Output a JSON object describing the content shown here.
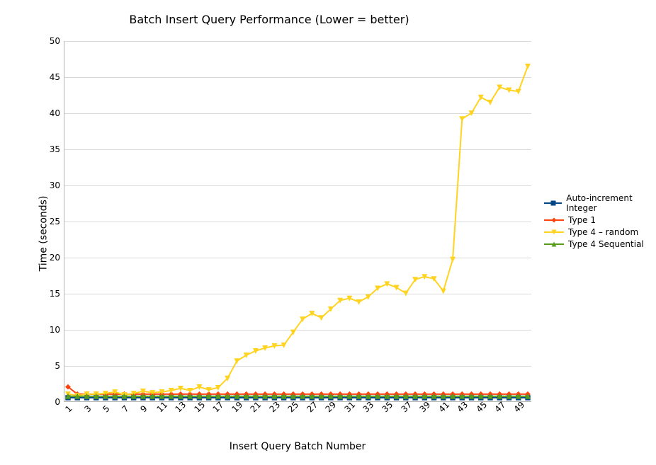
{
  "chart_data": {
    "type": "line",
    "title": "Batch Insert Query Performance (Lower = better)",
    "xlabel": "Insert Query Batch Number",
    "ylabel": "Time (seconds)",
    "ylim": [
      0,
      50
    ],
    "yticks": [
      0,
      5,
      10,
      15,
      20,
      25,
      30,
      35,
      40,
      45,
      50
    ],
    "x": [
      1,
      2,
      3,
      4,
      5,
      6,
      7,
      8,
      9,
      10,
      11,
      12,
      13,
      14,
      15,
      16,
      17,
      18,
      19,
      20,
      21,
      22,
      23,
      24,
      25,
      26,
      27,
      28,
      29,
      30,
      31,
      32,
      33,
      34,
      35,
      36,
      37,
      38,
      39,
      40,
      41,
      42,
      43,
      44,
      45,
      46,
      47,
      48,
      49,
      50
    ],
    "xticks_shown": [
      1,
      3,
      5,
      7,
      9,
      11,
      13,
      15,
      17,
      19,
      21,
      23,
      25,
      27,
      29,
      31,
      33,
      35,
      37,
      39,
      41,
      43,
      45,
      47,
      49
    ],
    "series": [
      {
        "name": "Auto-increment Integer",
        "color": "#004586",
        "marker": "square",
        "values": [
          0.5,
          0.5,
          0.5,
          0.5,
          0.5,
          0.5,
          0.5,
          0.5,
          0.5,
          0.5,
          0.5,
          0.5,
          0.5,
          0.5,
          0.5,
          0.5,
          0.5,
          0.5,
          0.5,
          0.5,
          0.5,
          0.5,
          0.5,
          0.5,
          0.5,
          0.5,
          0.5,
          0.5,
          0.5,
          0.5,
          0.5,
          0.5,
          0.5,
          0.5,
          0.5,
          0.5,
          0.5,
          0.5,
          0.5,
          0.5,
          0.5,
          0.5,
          0.5,
          0.5,
          0.5,
          0.5,
          0.5,
          0.5,
          0.5,
          0.5
        ]
      },
      {
        "name": "Type 1",
        "color": "#ff420e",
        "marker": "diamond",
        "values": [
          2.0,
          1.0,
          1.0,
          1.0,
          1.0,
          1.0,
          1.0,
          1.0,
          1.0,
          1.0,
          1.0,
          1.0,
          1.0,
          1.0,
          1.0,
          1.0,
          1.0,
          1.0,
          1.0,
          1.0,
          1.0,
          1.0,
          1.0,
          1.0,
          1.0,
          1.0,
          1.0,
          1.0,
          1.0,
          1.0,
          1.0,
          1.0,
          1.0,
          1.0,
          1.0,
          1.0,
          1.0,
          1.0,
          1.0,
          1.0,
          1.0,
          1.0,
          1.0,
          1.0,
          1.0,
          1.0,
          1.0,
          1.0,
          1.0,
          1.0
        ]
      },
      {
        "name": "Type 4 – random",
        "color": "#ffd320",
        "marker": "triangle-down",
        "values": [
          1.0,
          0.8,
          1.0,
          1.0,
          1.1,
          1.3,
          0.9,
          1.1,
          1.4,
          1.2,
          1.3,
          1.5,
          1.8,
          1.5,
          2.0,
          1.6,
          1.9,
          3.2,
          5.6,
          6.4,
          7.0,
          7.4,
          7.7,
          7.8,
          9.6,
          11.4,
          12.2,
          11.6,
          12.8,
          14.0,
          14.3,
          13.8,
          14.5,
          15.7,
          16.3,
          15.8,
          15.0,
          16.9,
          17.3,
          17.0,
          15.3,
          19.7,
          39.2,
          40.0,
          42.2,
          41.5,
          43.6,
          43.2,
          43.0,
          46.5
        ]
      },
      {
        "name": "Type 4 Sequential",
        "color": "#579d1c",
        "marker": "triangle-up",
        "values": [
          0.7,
          0.7,
          0.7,
          0.7,
          0.7,
          0.7,
          0.7,
          0.7,
          0.7,
          0.7,
          0.7,
          0.7,
          0.7,
          0.7,
          0.7,
          0.7,
          0.7,
          0.7,
          0.7,
          0.7,
          0.7,
          0.7,
          0.7,
          0.7,
          0.7,
          0.7,
          0.7,
          0.7,
          0.7,
          0.7,
          0.7,
          0.7,
          0.7,
          0.7,
          0.7,
          0.7,
          0.7,
          0.7,
          0.7,
          0.7,
          0.7,
          0.7,
          0.7,
          0.7,
          0.7,
          0.7,
          0.7,
          0.7,
          0.7,
          0.7
        ]
      }
    ],
    "legend_position": "right"
  }
}
